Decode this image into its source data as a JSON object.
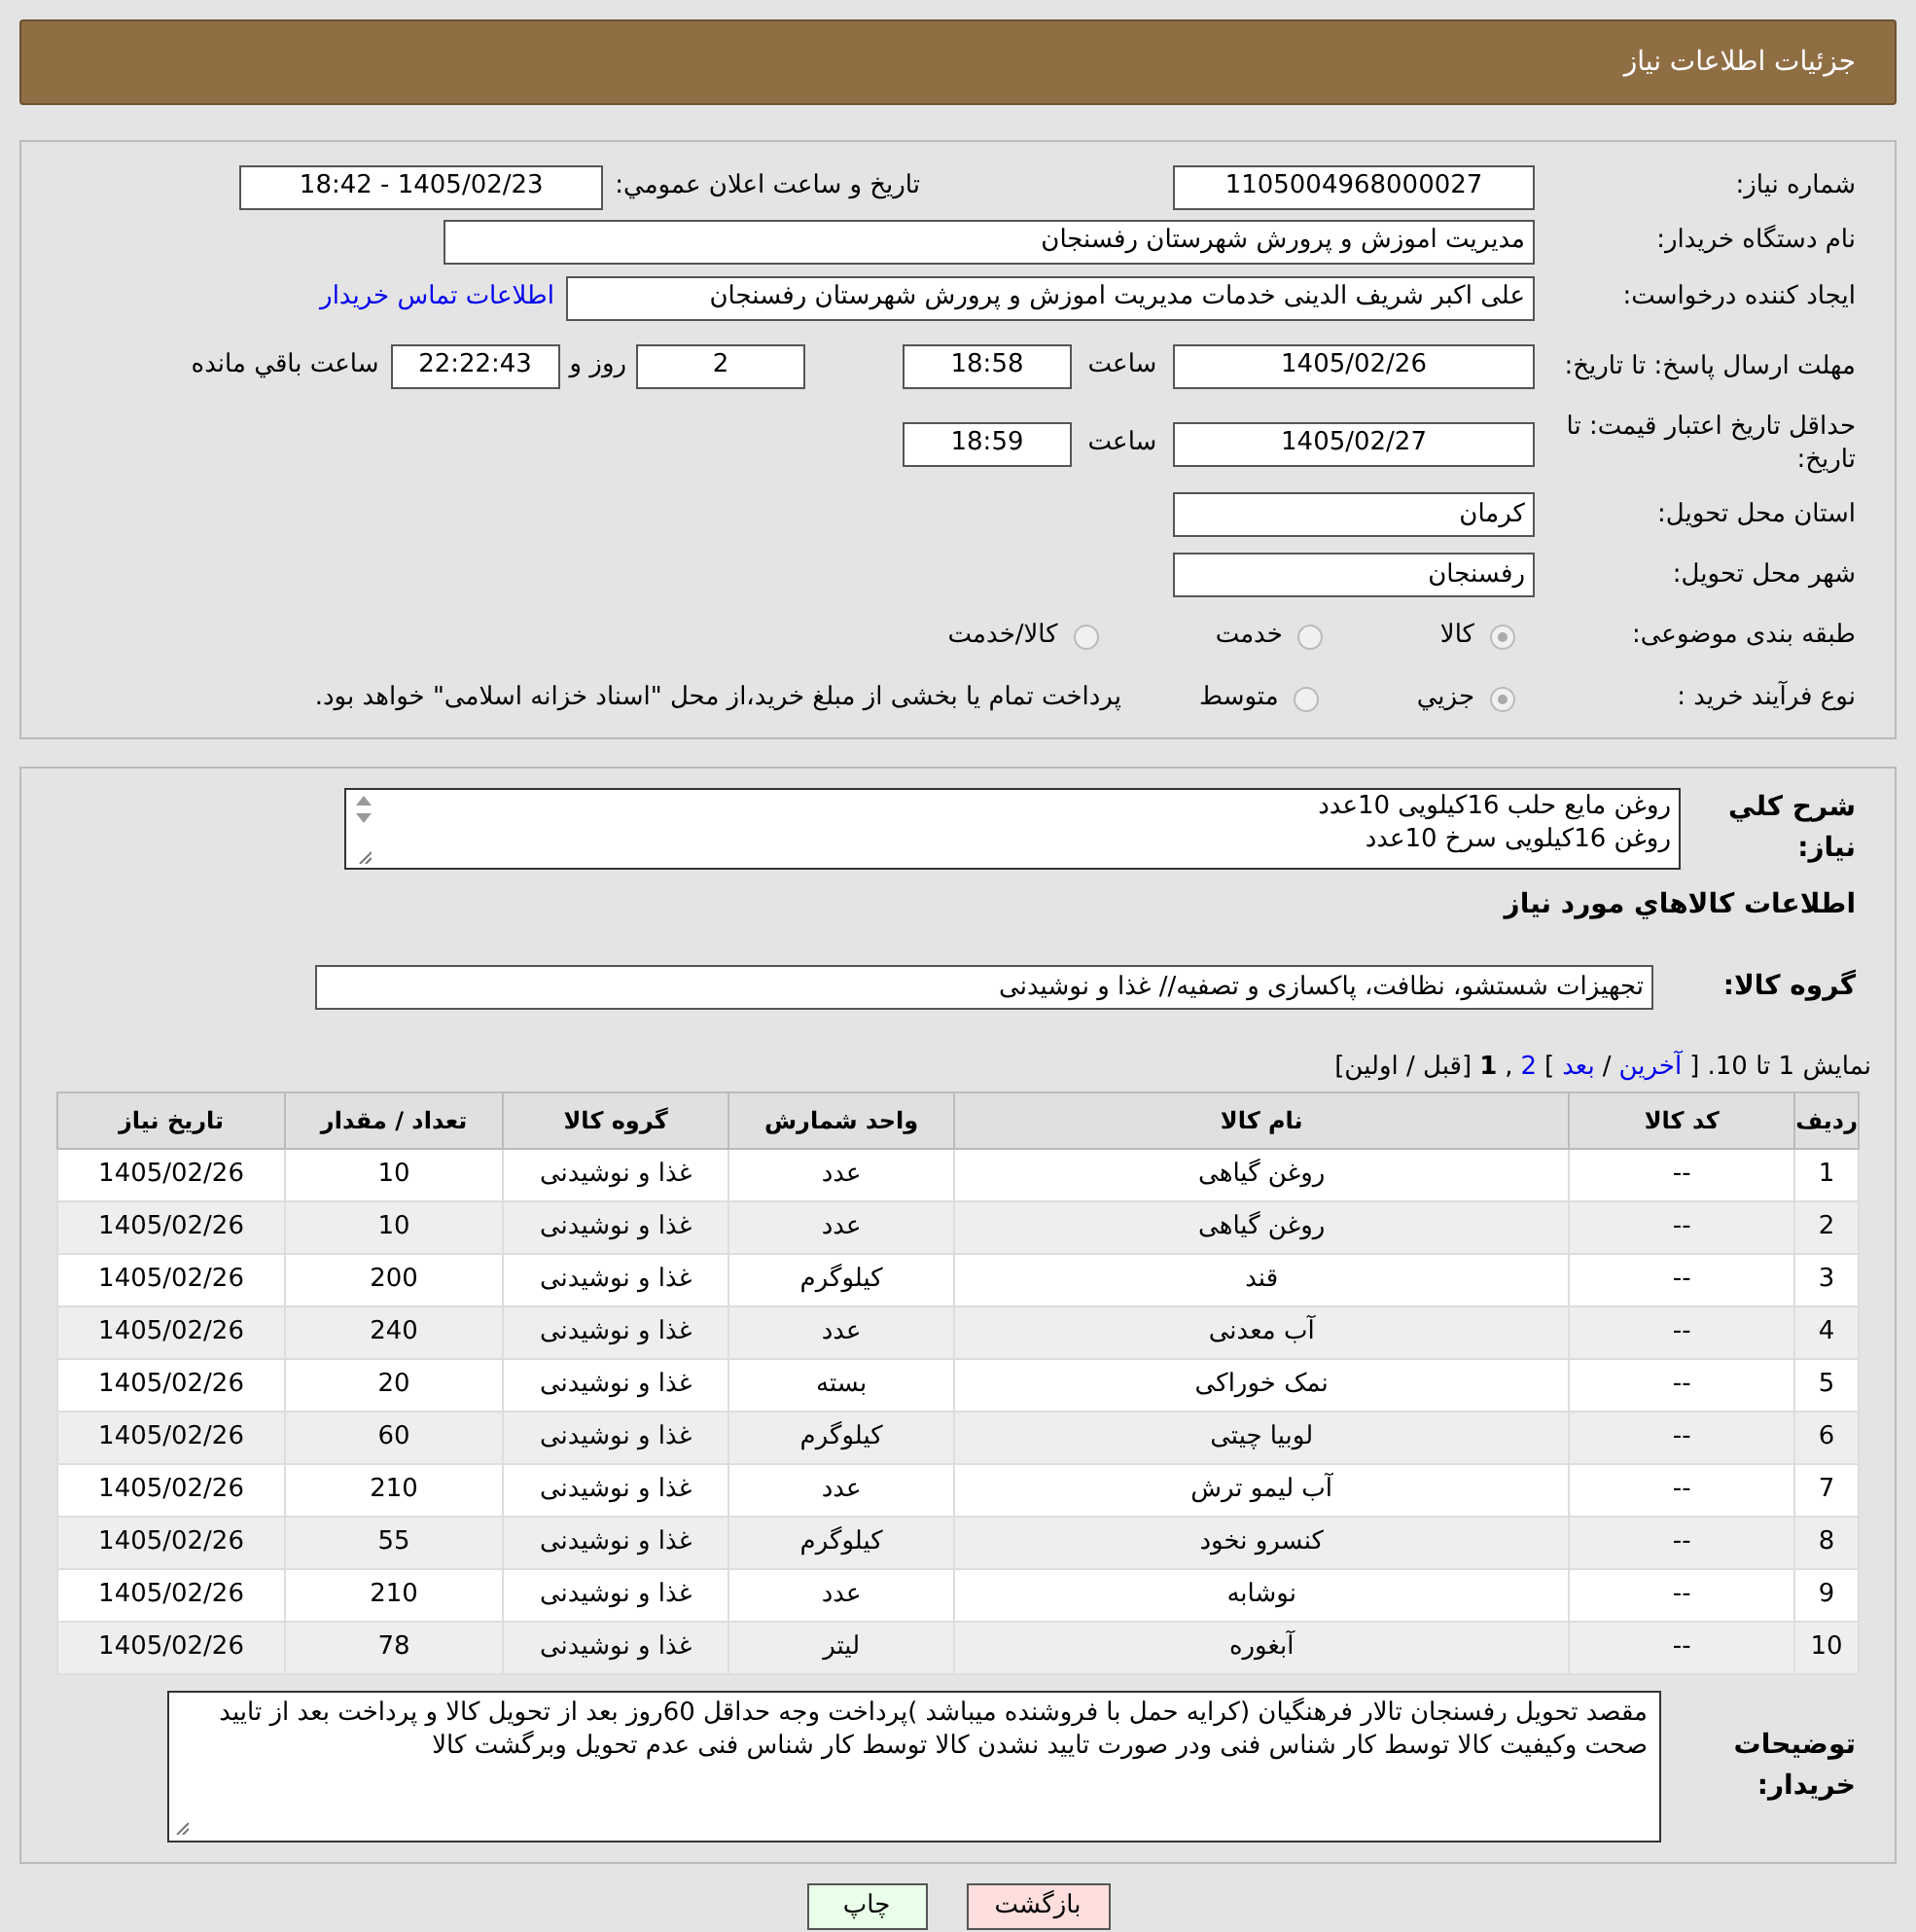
{
  "header": {
    "title": "جزئیات اطلاعات نیاز"
  },
  "info": {
    "need_number": {
      "label": "شماره نیاز:",
      "value": "1105004968000027"
    },
    "announce": {
      "label": "تاریخ و ساعت اعلان عمومي:",
      "value": "1405/02/23 - 18:42"
    },
    "buyer": {
      "label": "نام دستگاه خریدار:",
      "value": "مدیریت اموزش و پرورش شهرستان رفسنجان"
    },
    "creator": {
      "label": "ایجاد کننده درخواست:",
      "value": "علی اکبر شریف الدینی خدمات مدیریت اموزش و پرورش شهرستان رفسنجان",
      "link": "اطلاعات تماس خریدار"
    },
    "deadline": {
      "label": "مهلت ارسال پاسخ: تا تاریخ:",
      "date": "1405/02/26",
      "time_label": "ساعت",
      "time": "18:58",
      "days": "2",
      "days_label": "روز و",
      "remaining": "22:22:43",
      "remaining_label": "ساعت باقي مانده"
    },
    "validity": {
      "label": "حداقل تاریخ اعتبار قیمت: تا تاریخ:",
      "date": "1405/02/27",
      "time_label": "ساعت",
      "time": "18:59"
    },
    "province": {
      "label": "استان محل تحویل:",
      "value": "کرمان"
    },
    "city": {
      "label": "شهر محل تحویل:",
      "value": "رفسنجان"
    },
    "category": {
      "label": "طبقه بندی موضوعی:",
      "options": [
        {
          "label": "کالا",
          "selected": true
        },
        {
          "label": "خدمت",
          "selected": false
        },
        {
          "label": "کالا/خدمت",
          "selected": false
        }
      ]
    },
    "process": {
      "label": "نوع فرآیند خرید :",
      "options": [
        {
          "label": "جزيي",
          "selected": true
        },
        {
          "label": "متوسط",
          "selected": false
        }
      ],
      "note": "پرداخت تمام یا بخشی از مبلغ خرید،از محل \"اسناد خزانه اسلامی\" خواهد بود."
    }
  },
  "details": {
    "summary": {
      "label": "شرح کلي نیاز:",
      "lines": [
        "روغن مایع حلب 16کیلویی 10عدد",
        "روغن 16کیلویی سرخ 10عدد"
      ]
    },
    "goods_heading": "اطلاعات کالاهاي مورد نیاز",
    "goods_group": {
      "label": "گروه کالا:",
      "value": "تجهیزات شستشو، نظافت، پاکسازی و تصفیه// غذا و نوشیدنی"
    },
    "pagination": [
      {
        "kind": "text",
        "text": "نمایش 1 تا 10. ["
      },
      {
        "kind": "link",
        "text": "آخرین"
      },
      {
        "kind": "text",
        "text": "/"
      },
      {
        "kind": "link",
        "text": "بعد"
      },
      {
        "kind": "text",
        "text": "]"
      },
      {
        "kind": "link",
        "text": "2"
      },
      {
        "kind": "text",
        "text": ","
      },
      {
        "kind": "current",
        "text": "1"
      },
      {
        "kind": "text",
        "text": "[قبل / اولین]"
      }
    ],
    "table": {
      "columns": [
        "ردیف",
        "کد کالا",
        "نام کالا",
        "واحد شمارش",
        "گروه کالا",
        "تعداد / مقدار",
        "تاریخ نیاز"
      ],
      "rows": [
        [
          "1",
          "--",
          "روغن گیاهی",
          "عدد",
          "غذا و نوشیدنی",
          "10",
          "1405/02/26"
        ],
        [
          "2",
          "--",
          "روغن گیاهی",
          "عدد",
          "غذا و نوشیدنی",
          "10",
          "1405/02/26"
        ],
        [
          "3",
          "--",
          "قند",
          "کیلوگرم",
          "غذا و نوشیدنی",
          "200",
          "1405/02/26"
        ],
        [
          "4",
          "--",
          "آب معدنی",
          "عدد",
          "غذا و نوشیدنی",
          "240",
          "1405/02/26"
        ],
        [
          "5",
          "--",
          "نمک خوراکی",
          "بسته",
          "غذا و نوشیدنی",
          "20",
          "1405/02/26"
        ],
        [
          "6",
          "--",
          "لوبیا چیتی",
          "کیلوگرم",
          "غذا و نوشیدنی",
          "60",
          "1405/02/26"
        ],
        [
          "7",
          "--",
          "آب لیمو ترش",
          "عدد",
          "غذا و نوشیدنی",
          "210",
          "1405/02/26"
        ],
        [
          "8",
          "--",
          "کنسرو نخود",
          "کیلوگرم",
          "غذا و نوشیدنی",
          "55",
          "1405/02/26"
        ],
        [
          "9",
          "--",
          "نوشابه",
          "عدد",
          "غذا و نوشیدنی",
          "210",
          "1405/02/26"
        ],
        [
          "10",
          "--",
          "آبغوره",
          "لیتر",
          "غذا و نوشیدنی",
          "78",
          "1405/02/26"
        ]
      ]
    },
    "buyer_notes": {
      "label": "توضیحات خریدار:",
      "value": "مقصد تحویل رفسنجان تالار فرهنگیان (کرایه حمل با فروشنده میباشد )پرداخت وجه حداقل 60روز بعد از تحویل کالا و پرداخت بعد از تایید صحت وکیفیت کالا توسط کار شناس فنی ودر صورت تایید نشدن کالا توسط کار شناس فنی عدم تحویل وبرگشت کالا"
    }
  },
  "buttons": [
    {
      "kind": "back",
      "label": "بازگشت"
    },
    {
      "kind": "print",
      "label": "چاپ"
    }
  ]
}
